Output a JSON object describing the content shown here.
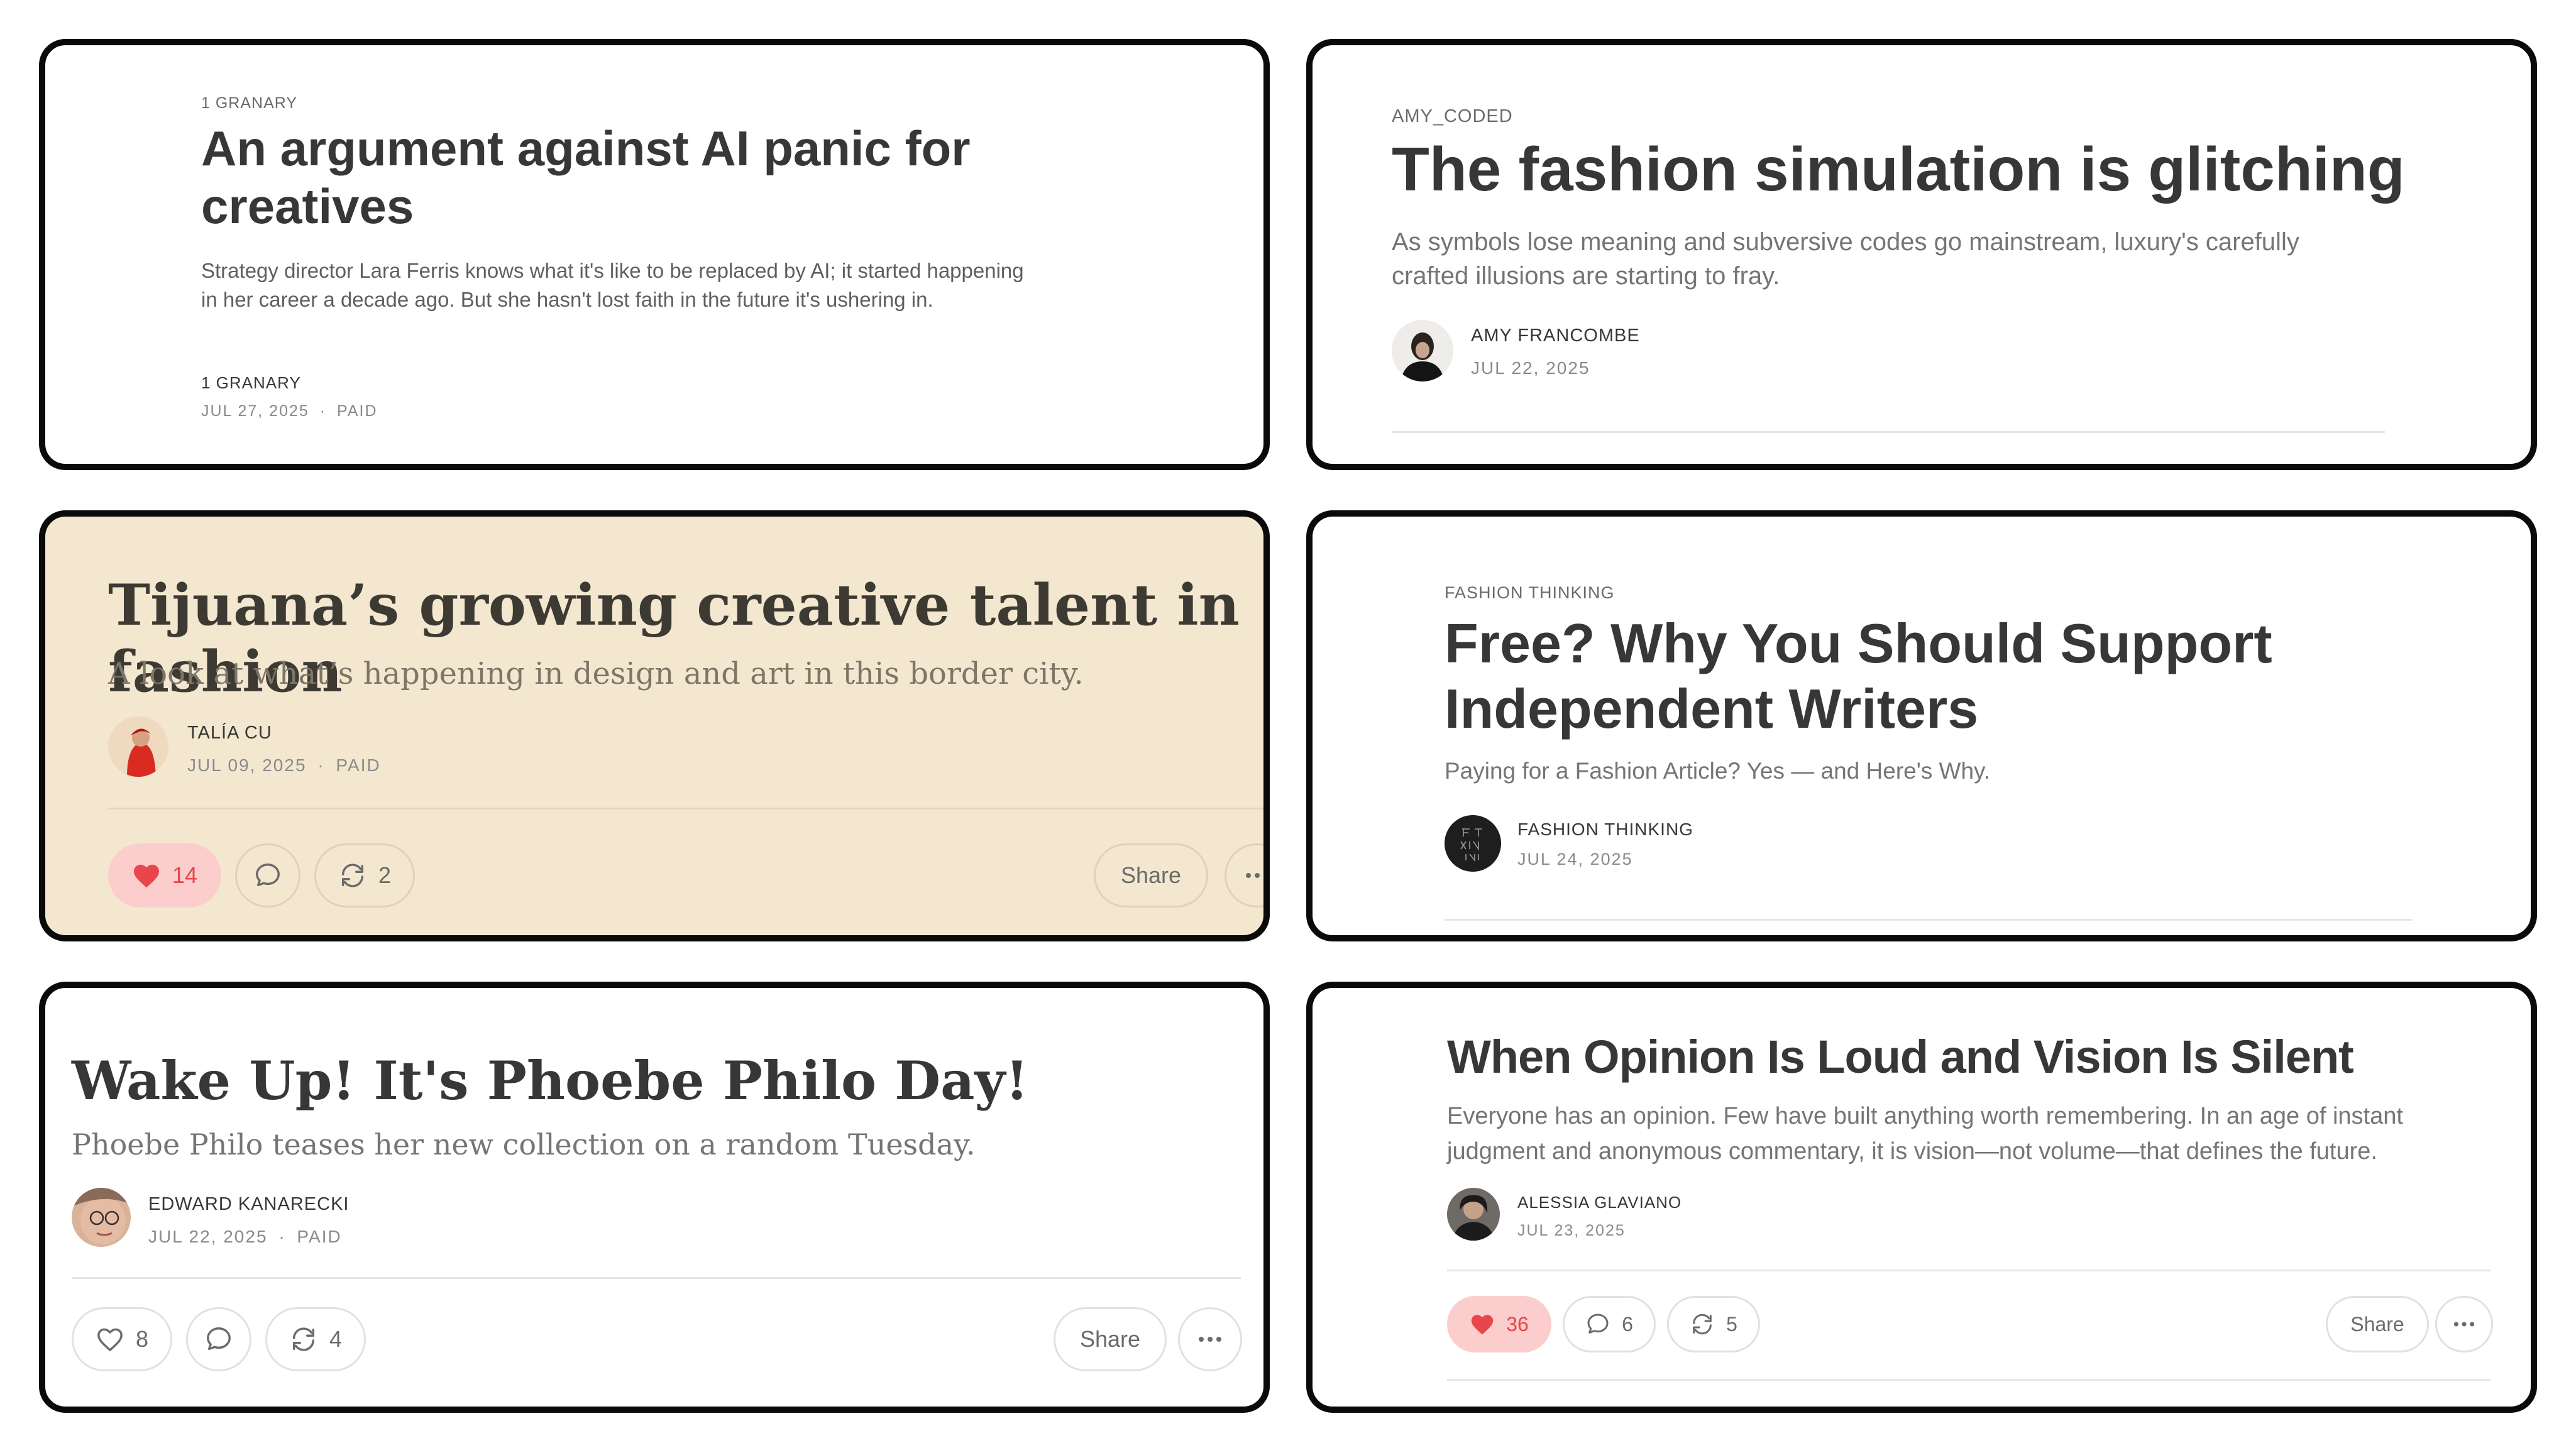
{
  "cards": [
    {
      "publication": "1 GRANARY",
      "title": "An argument against AI panic for creatives",
      "subtitle": "Strategy director Lara Ferris knows what it's like to be replaced by AI; it started happening in her career a decade ago. But she hasn't lost faith in the future it's ushering in.",
      "author": "1 GRANARY",
      "date": "JUL 27, 2025",
      "paid": "PAID"
    },
    {
      "publication": "AMY_CODED",
      "title": "The fashion simulation is glitching",
      "subtitle": "As symbols lose meaning and subversive codes go mainstream, luxury's carefully crafted illusions are starting to fray.",
      "author": "AMY FRANCOMBE",
      "date": "JUL 22, 2025"
    },
    {
      "title": "Tijuana’s growing creative talent in fashion",
      "subtitle": "A look at what’s happening in design and art in this border city.",
      "author": "TALÍA CU",
      "date": "JUL 09, 2025",
      "paid": "PAID",
      "likes": "14",
      "restacks": "2",
      "share_label": "Share",
      "background": "#f3e8cf"
    },
    {
      "publication": "FASHION THINKING",
      "title": "Free? Why You Should Support Independent Writers",
      "subtitle": "Paying for a Fashion Article? Yes — and Here's Why.",
      "author": "FASHION THINKING",
      "date": "JUL 24, 2025"
    },
    {
      "title": "Wake Up! It's Phoebe Philo Day!",
      "subtitle": "Phoebe Philo teases her new collection on a random Tuesday.",
      "author": "EDWARD KANARECKI",
      "date": "JUL 22, 2025",
      "paid": "PAID",
      "likes": "8",
      "restacks": "4",
      "share_label": "Share"
    },
    {
      "title": "When Opinion Is Loud and Vision Is Silent",
      "subtitle": "Everyone has an opinion. Few have built anything worth remembering. In an age of instant judgment and anonymous commentary, it is vision—not volume—that defines the future.",
      "author": "ALESSIA GLAVIANO",
      "date": "JUL 23, 2025",
      "likes": "36",
      "comments": "6",
      "restacks": "5",
      "share_label": "Share"
    }
  ],
  "separator": "·",
  "colors": {
    "card_border": "#0a0a0a",
    "liked_bg": "#fccdcd",
    "liked_fg": "#e8464a",
    "beige_bg": "#f3e8cf"
  },
  "icons": [
    "heart-icon",
    "comment-icon",
    "restack-icon",
    "more-icon"
  ]
}
